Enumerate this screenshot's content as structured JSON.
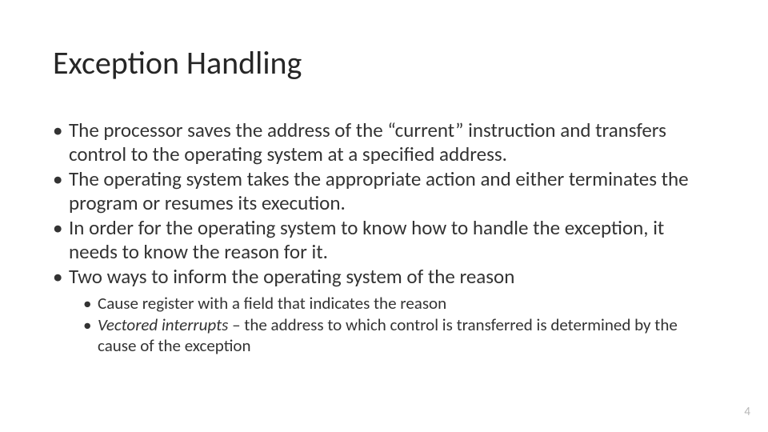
{
  "slide": {
    "title": "Exception Handling",
    "bullets": [
      "The processor saves the address of the “current” instruction and transfers control to the operating system at a specified address.",
      "The operating system takes the appropriate action and either terminates the program or resumes its execution.",
      "In order for the operating system to know how to handle the exception, it needs to know the reason for it.",
      "Two ways to inform the operating system of the reason"
    ],
    "sub_bullets": [
      {
        "prefix": "",
        "italic": "",
        "rest": "Cause register with a field that indicates the reason"
      },
      {
        "prefix": "",
        "italic": "Vectored interrupts",
        "rest": " – the address to which control is transferred is determined by the cause of the exception"
      }
    ],
    "page_number": "4"
  }
}
